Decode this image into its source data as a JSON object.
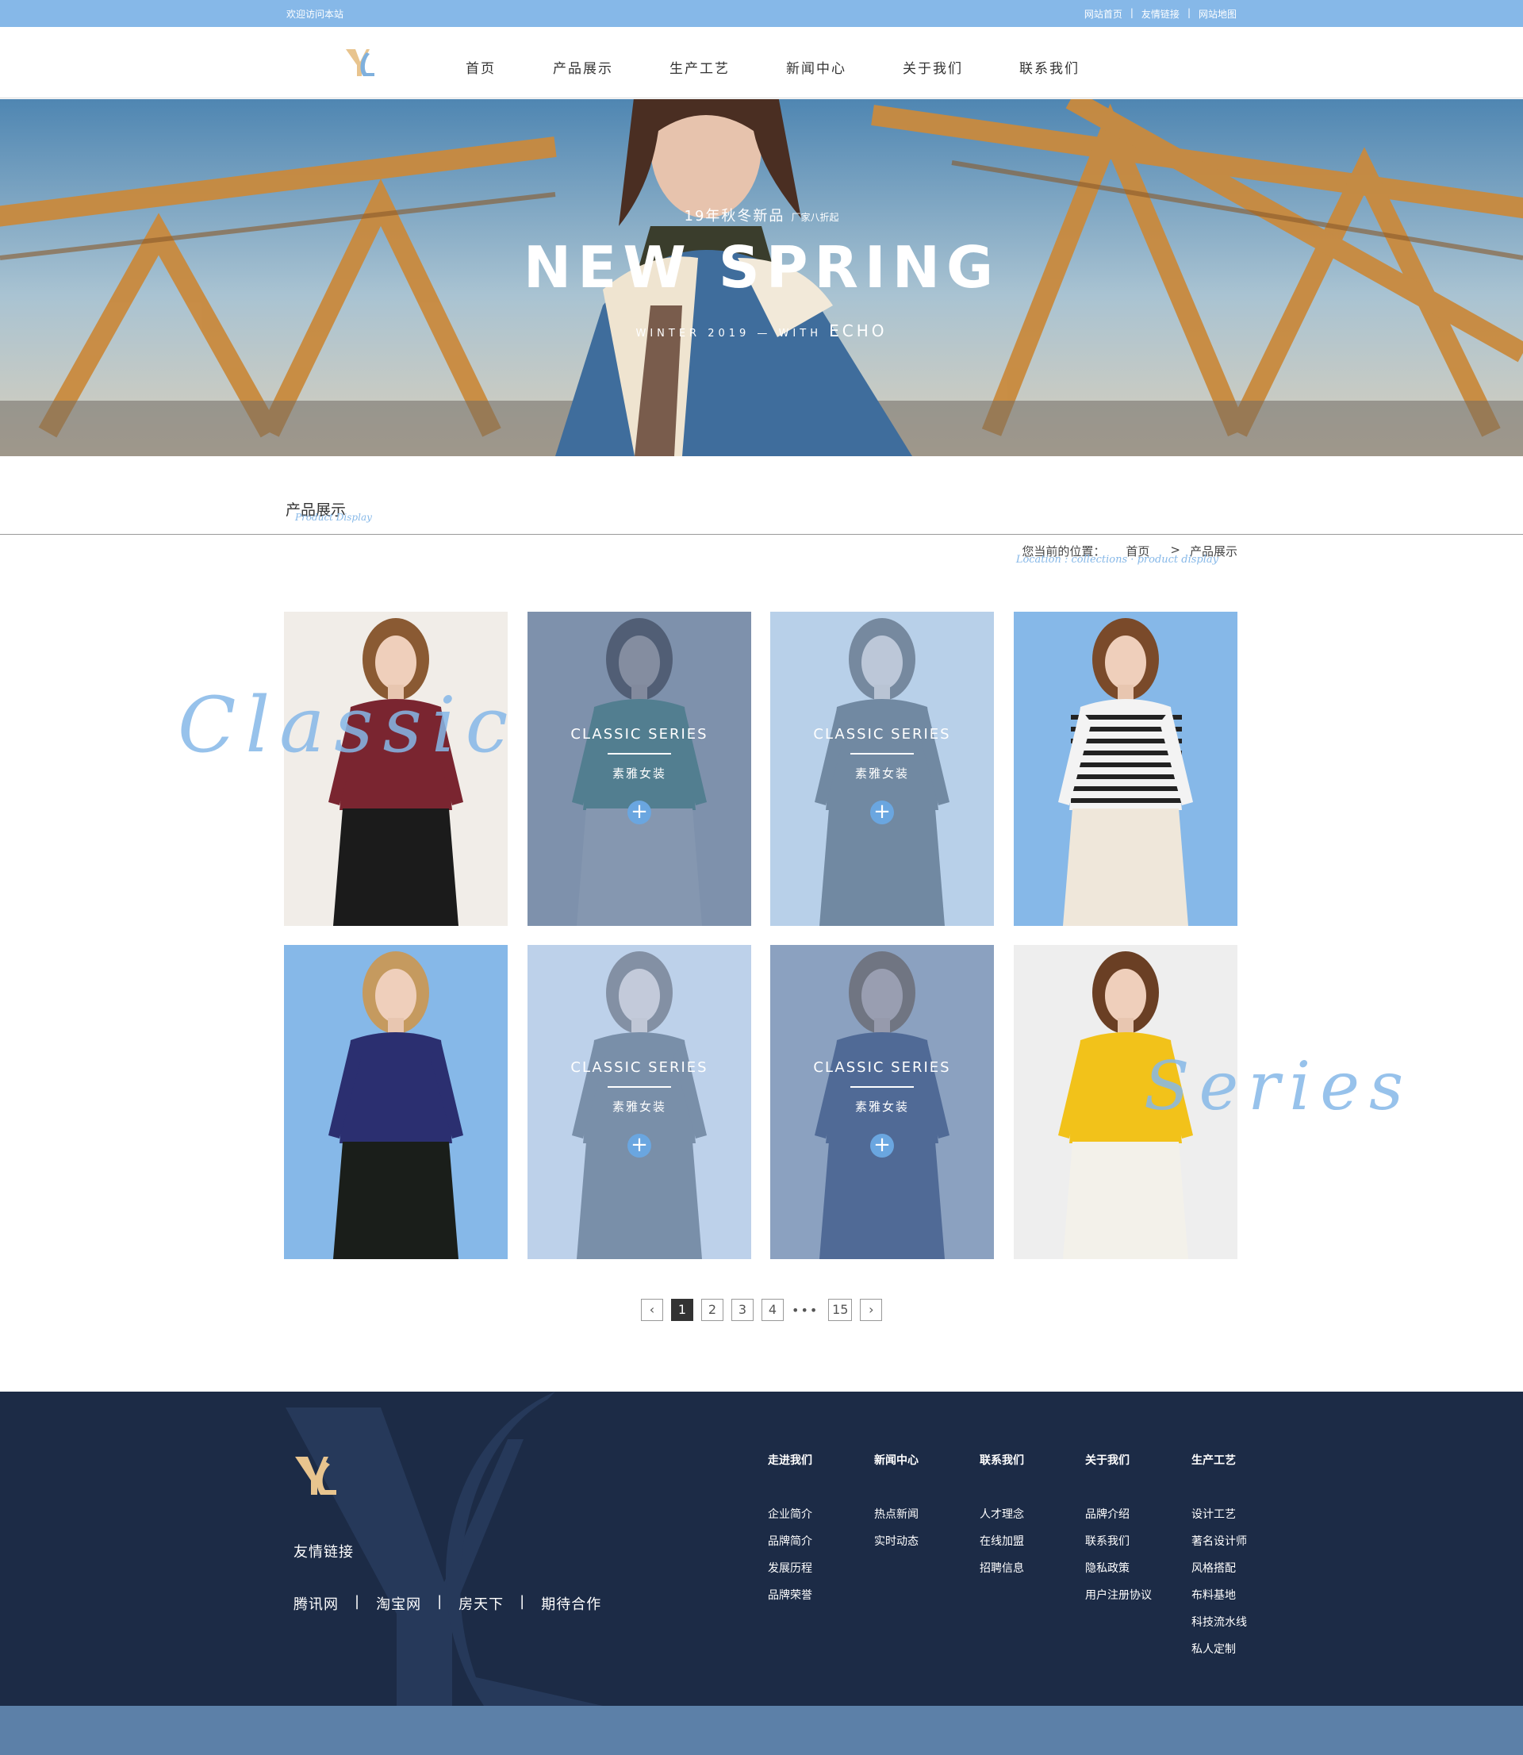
{
  "topbar": {
    "welcome": "欢迎访问本站",
    "links": [
      "网站首页",
      "友情链接",
      "网站地图"
    ],
    "separator": "|"
  },
  "nav": {
    "items": [
      "首页",
      "产品展示",
      "生产工艺",
      "新闻中心",
      "关于我们",
      "联系我们"
    ]
  },
  "hero": {
    "subtitle": "19年秋冬新品",
    "subtitle_note": "厂家八折起",
    "headline": "NEW SPRING",
    "tagline_prefix": "WINTER 2019 — WITH",
    "tagline_name": "ECHO"
  },
  "section": {
    "title": "产品展示",
    "title_en": "Product Display",
    "breadcrumb_label": "您当前的位置：",
    "breadcrumb_home": "首页",
    "breadcrumb_sep": ">",
    "breadcrumb_current": "产品展示",
    "breadcrumb_en": "Location : collections  ·  product display"
  },
  "decor": {
    "left_script": "Classic",
    "right_script": "Series"
  },
  "products": [
    {
      "overlay": false,
      "bg": "#f1ede8",
      "cloth": "#7a2530",
      "skirt": "#1b1b1b",
      "hair": "#8a5a33"
    },
    {
      "overlay": true,
      "title": "CLASSIC SERIES",
      "subtitle": "素雅女装",
      "plus": "+",
      "bg": "#d9dfe6",
      "cloth": "#3d9a80",
      "skirt": "#f4f4f4",
      "hair": "#3a2a22",
      "tint": "rgba(90,115,150,0.72)"
    },
    {
      "overlay": true,
      "title": "CLASSIC SERIES",
      "subtitle": "素雅女装",
      "plus": "+",
      "bg": "#e6e8ea",
      "cloth": "#1b1d22",
      "skirt": "#1b1d22",
      "hair": "#2a1d18",
      "tint": "rgba(160,195,232,0.65)"
    },
    {
      "overlay": false,
      "bg": "#86b8e8",
      "cloth": "#f3f3f3",
      "skirt": "#efe7da",
      "hair": "#7a4a2a",
      "stripes": true
    },
    {
      "overlay": false,
      "bg": "#86b8e8",
      "cloth": "#2b2f70",
      "skirt": "#1a1e1a",
      "hair": "#c59a5f"
    },
    {
      "overlay": true,
      "title": "CLASSIC SERIES",
      "subtitle": "素雅女装",
      "plus": "+",
      "bg": "#dfe3e8",
      "cloth": "#1f2530",
      "skirt": "#1f2530",
      "hair": "#3a2a22",
      "tint": "rgba(170,200,235,0.65)"
    },
    {
      "overlay": true,
      "title": "CLASSIC SERIES",
      "subtitle": "素雅女装",
      "plus": "+",
      "bg": "#cdd6e0",
      "cloth": "#3a4e78",
      "skirt": "#3a4e78",
      "hair": "#8a6a48",
      "tint": "rgba(95,125,170,0.6)"
    },
    {
      "overlay": false,
      "bg": "#eeeeee",
      "cloth": "#f2c21a",
      "skirt": "#f3f1ea",
      "hair": "#6a3f24"
    }
  ],
  "pagination": {
    "prev": "‹",
    "pages": [
      "1",
      "2",
      "3",
      "4"
    ],
    "dots": "•••",
    "last": "15",
    "next": "›",
    "current": "1"
  },
  "footer": {
    "links_title": "友情链接",
    "links": [
      "腾讯网",
      "淘宝网",
      "房天下",
      "期待合作"
    ],
    "separator": "|",
    "columns": [
      {
        "title": "走进我们",
        "items": [
          "企业简介",
          "品牌简介",
          "发展历程",
          "品牌荣誉"
        ]
      },
      {
        "title": "新闻中心",
        "items": [
          "热点新闻",
          "实时动态"
        ]
      },
      {
        "title": "联系我们",
        "items": [
          "人才理念",
          "在线加盟",
          "招聘信息"
        ]
      },
      {
        "title": "关于我们",
        "items": [
          "品牌介绍",
          "联系我们",
          "隐私政策",
          "用户注册协议"
        ]
      },
      {
        "title": "生产工艺",
        "items": [
          "设计工艺",
          "著名设计师",
          "风格搭配",
          "布料基地",
          "科技流水线",
          "私人定制"
        ]
      }
    ]
  },
  "colors": {
    "accent": "#86b8e8",
    "footer_bg": "#1c2b46",
    "strip": "#5c80a8",
    "gold": "#e8c48e"
  }
}
